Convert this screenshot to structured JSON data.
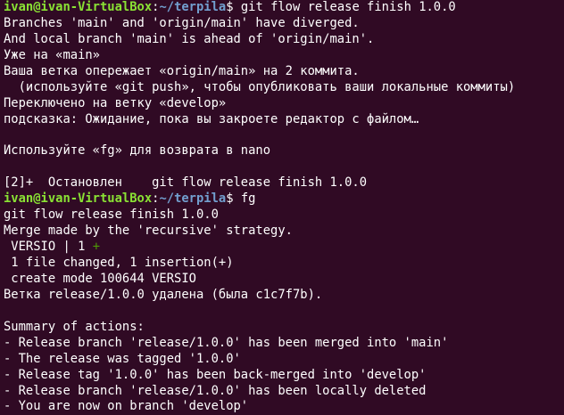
{
  "colors": {
    "background": "#300a24",
    "foreground": "#ffffff",
    "prompt_user": "#8ae234",
    "prompt_path": "#729fcf",
    "diff_added": "#4e9a06"
  },
  "prompt": {
    "user_host": "ivan@ivan-VirtualBox",
    "colon": ":",
    "path": "~/terpila",
    "symbol": "$ "
  },
  "lines": {
    "l1_cmd": "git flow release finish 1.0.0",
    "l2": "Branches 'main' and 'origin/main' have diverged.",
    "l3": "And local branch 'main' is ahead of 'origin/main'.",
    "l4": "Уже на «main»",
    "l5": "Ваша ветка опережает «origin/main» на 2 коммита.",
    "l6": "  (используйте «git push», чтобы опубликовать ваши локальные коммиты)",
    "l7": "Переключено на ветку «develop»",
    "l8": "подсказка: Ожидание, пока вы закроете редактор с файлом…",
    "l9": "",
    "l10": "Используйте «fg» для возврата в nano",
    "l11": "",
    "l12": "[2]+  Остановлен    git flow release finish 1.0.0",
    "l13_cmd": "fg",
    "l14": "git flow release finish 1.0.0",
    "l15": "Merge made by the 'recursive' strategy.",
    "l16_text": " VERSIO | 1 ",
    "l16_plus": "+",
    "l17": " 1 file changed, 1 insertion(+)",
    "l18": " create mode 100644 VERSIO",
    "l19": "Ветка release/1.0.0 удалена (была c1c7f7b).",
    "l20": "",
    "l21": "Summary of actions:",
    "l22": "- Release branch 'release/1.0.0' has been merged into 'main'",
    "l23": "- The release was tagged '1.0.0'",
    "l24": "- Release tag '1.0.0' has been back-merged into 'develop'",
    "l25": "- Release branch 'release/1.0.0' has been locally deleted",
    "l26": "- You are now on branch 'develop'"
  }
}
